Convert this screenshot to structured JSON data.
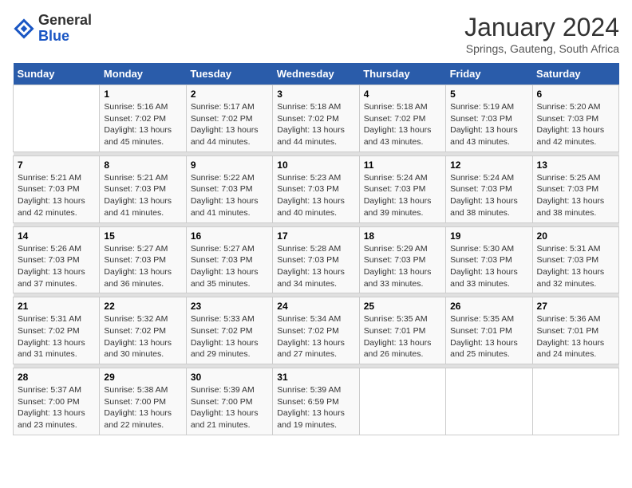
{
  "logo": {
    "general": "General",
    "blue": "Blue"
  },
  "title": "January 2024",
  "subtitle": "Springs, Gauteng, South Africa",
  "days_header": [
    "Sunday",
    "Monday",
    "Tuesday",
    "Wednesday",
    "Thursday",
    "Friday",
    "Saturday"
  ],
  "weeks": [
    [
      {
        "num": "",
        "info": ""
      },
      {
        "num": "1",
        "info": "Sunrise: 5:16 AM\nSunset: 7:02 PM\nDaylight: 13 hours\nand 45 minutes."
      },
      {
        "num": "2",
        "info": "Sunrise: 5:17 AM\nSunset: 7:02 PM\nDaylight: 13 hours\nand 44 minutes."
      },
      {
        "num": "3",
        "info": "Sunrise: 5:18 AM\nSunset: 7:02 PM\nDaylight: 13 hours\nand 44 minutes."
      },
      {
        "num": "4",
        "info": "Sunrise: 5:18 AM\nSunset: 7:02 PM\nDaylight: 13 hours\nand 43 minutes."
      },
      {
        "num": "5",
        "info": "Sunrise: 5:19 AM\nSunset: 7:03 PM\nDaylight: 13 hours\nand 43 minutes."
      },
      {
        "num": "6",
        "info": "Sunrise: 5:20 AM\nSunset: 7:03 PM\nDaylight: 13 hours\nand 42 minutes."
      }
    ],
    [
      {
        "num": "7",
        "info": "Sunrise: 5:21 AM\nSunset: 7:03 PM\nDaylight: 13 hours\nand 42 minutes."
      },
      {
        "num": "8",
        "info": "Sunrise: 5:21 AM\nSunset: 7:03 PM\nDaylight: 13 hours\nand 41 minutes."
      },
      {
        "num": "9",
        "info": "Sunrise: 5:22 AM\nSunset: 7:03 PM\nDaylight: 13 hours\nand 41 minutes."
      },
      {
        "num": "10",
        "info": "Sunrise: 5:23 AM\nSunset: 7:03 PM\nDaylight: 13 hours\nand 40 minutes."
      },
      {
        "num": "11",
        "info": "Sunrise: 5:24 AM\nSunset: 7:03 PM\nDaylight: 13 hours\nand 39 minutes."
      },
      {
        "num": "12",
        "info": "Sunrise: 5:24 AM\nSunset: 7:03 PM\nDaylight: 13 hours\nand 38 minutes."
      },
      {
        "num": "13",
        "info": "Sunrise: 5:25 AM\nSunset: 7:03 PM\nDaylight: 13 hours\nand 38 minutes."
      }
    ],
    [
      {
        "num": "14",
        "info": "Sunrise: 5:26 AM\nSunset: 7:03 PM\nDaylight: 13 hours\nand 37 minutes."
      },
      {
        "num": "15",
        "info": "Sunrise: 5:27 AM\nSunset: 7:03 PM\nDaylight: 13 hours\nand 36 minutes."
      },
      {
        "num": "16",
        "info": "Sunrise: 5:27 AM\nSunset: 7:03 PM\nDaylight: 13 hours\nand 35 minutes."
      },
      {
        "num": "17",
        "info": "Sunrise: 5:28 AM\nSunset: 7:03 PM\nDaylight: 13 hours\nand 34 minutes."
      },
      {
        "num": "18",
        "info": "Sunrise: 5:29 AM\nSunset: 7:03 PM\nDaylight: 13 hours\nand 33 minutes."
      },
      {
        "num": "19",
        "info": "Sunrise: 5:30 AM\nSunset: 7:03 PM\nDaylight: 13 hours\nand 33 minutes."
      },
      {
        "num": "20",
        "info": "Sunrise: 5:31 AM\nSunset: 7:03 PM\nDaylight: 13 hours\nand 32 minutes."
      }
    ],
    [
      {
        "num": "21",
        "info": "Sunrise: 5:31 AM\nSunset: 7:02 PM\nDaylight: 13 hours\nand 31 minutes."
      },
      {
        "num": "22",
        "info": "Sunrise: 5:32 AM\nSunset: 7:02 PM\nDaylight: 13 hours\nand 30 minutes."
      },
      {
        "num": "23",
        "info": "Sunrise: 5:33 AM\nSunset: 7:02 PM\nDaylight: 13 hours\nand 29 minutes."
      },
      {
        "num": "24",
        "info": "Sunrise: 5:34 AM\nSunset: 7:02 PM\nDaylight: 13 hours\nand 27 minutes."
      },
      {
        "num": "25",
        "info": "Sunrise: 5:35 AM\nSunset: 7:01 PM\nDaylight: 13 hours\nand 26 minutes."
      },
      {
        "num": "26",
        "info": "Sunrise: 5:35 AM\nSunset: 7:01 PM\nDaylight: 13 hours\nand 25 minutes."
      },
      {
        "num": "27",
        "info": "Sunrise: 5:36 AM\nSunset: 7:01 PM\nDaylight: 13 hours\nand 24 minutes."
      }
    ],
    [
      {
        "num": "28",
        "info": "Sunrise: 5:37 AM\nSunset: 7:00 PM\nDaylight: 13 hours\nand 23 minutes."
      },
      {
        "num": "29",
        "info": "Sunrise: 5:38 AM\nSunset: 7:00 PM\nDaylight: 13 hours\nand 22 minutes."
      },
      {
        "num": "30",
        "info": "Sunrise: 5:39 AM\nSunset: 7:00 PM\nDaylight: 13 hours\nand 21 minutes."
      },
      {
        "num": "31",
        "info": "Sunrise: 5:39 AM\nSunset: 6:59 PM\nDaylight: 13 hours\nand 19 minutes."
      },
      {
        "num": "",
        "info": ""
      },
      {
        "num": "",
        "info": ""
      },
      {
        "num": "",
        "info": ""
      }
    ]
  ]
}
